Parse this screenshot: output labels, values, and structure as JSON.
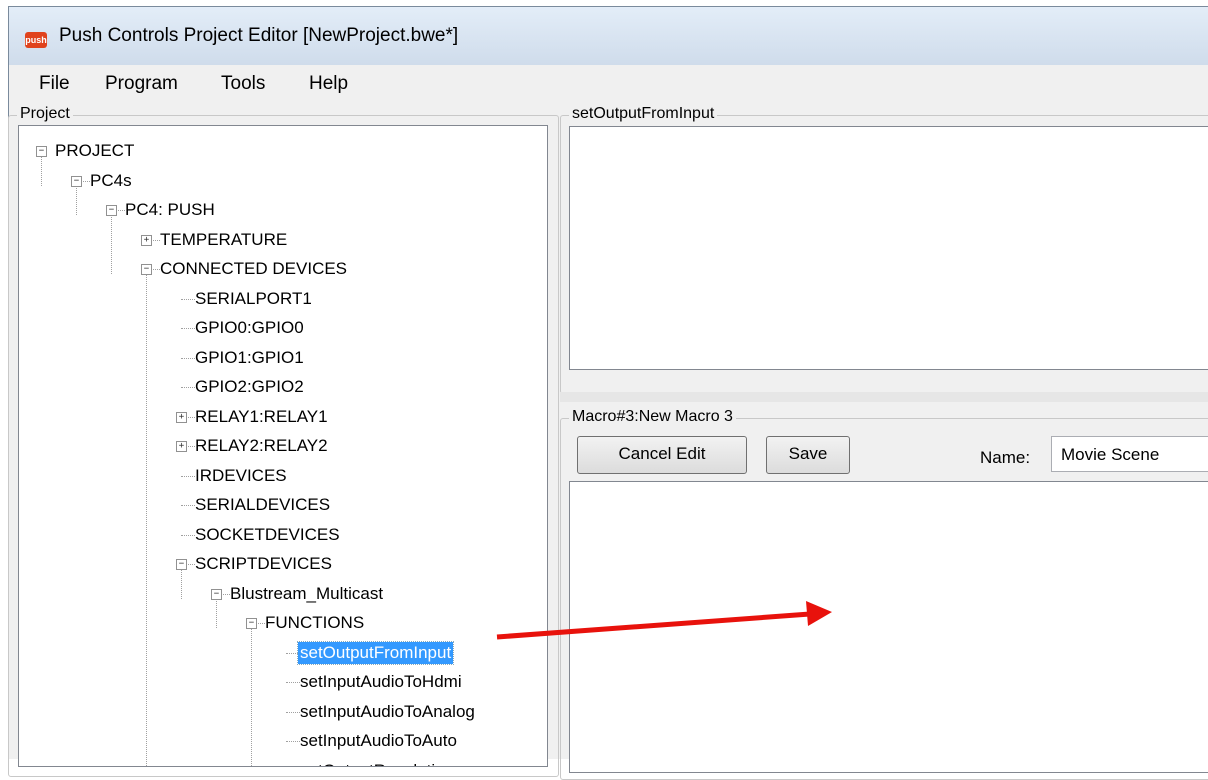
{
  "window": {
    "title": "Push Controls Project Editor [NewProject.bwe*]",
    "logo_text": "push",
    "logo_color": "#e0431d"
  },
  "menu": [
    "File",
    "Program",
    "Tools",
    "Help"
  ],
  "project_panel": {
    "title": "Project",
    "tree": [
      {
        "label": "PROJECT",
        "toggle": "minus"
      },
      {
        "label": "PC4s",
        "toggle": "minus"
      },
      {
        "label": "PC4: PUSH",
        "toggle": "minus"
      },
      {
        "label": "TEMPERATURE",
        "toggle": "plus"
      },
      {
        "label": "CONNECTED DEVICES",
        "toggle": "minus"
      },
      {
        "label": "SERIALPORT1",
        "toggle": ""
      },
      {
        "label": "GPIO0:GPIO0",
        "toggle": ""
      },
      {
        "label": "GPIO1:GPIO1",
        "toggle": ""
      },
      {
        "label": "GPIO2:GPIO2",
        "toggle": ""
      },
      {
        "label": "RELAY1:RELAY1",
        "toggle": "plus"
      },
      {
        "label": "RELAY2:RELAY2",
        "toggle": "plus"
      },
      {
        "label": "IRDEVICES",
        "toggle": ""
      },
      {
        "label": "SERIALDEVICES",
        "toggle": ""
      },
      {
        "label": "SOCKETDEVICES",
        "toggle": ""
      },
      {
        "label": "SCRIPTDEVICES",
        "toggle": "minus"
      },
      {
        "label": "Blustream_Multicast",
        "toggle": "minus"
      },
      {
        "label": "FUNCTIONS",
        "toggle": "minus"
      },
      {
        "label": "setOutputFromInput",
        "toggle": "",
        "selected": true
      },
      {
        "label": "setInputAudioToHdmi",
        "toggle": ""
      },
      {
        "label": "setInputAudioToAnalog",
        "toggle": ""
      },
      {
        "label": "setInputAudioToAuto",
        "toggle": ""
      },
      {
        "label": "setOutputResolution",
        "toggle": ""
      }
    ]
  },
  "function_panel": {
    "title": "setOutputFromInput"
  },
  "macro_panel": {
    "title": "Macro#3:New Macro 3",
    "cancel_label": "Cancel Edit",
    "save_label": "Save",
    "name_label": "Name:",
    "name_value": "Movie Scene"
  },
  "annotation": {
    "arrow_color": "#e8120c"
  }
}
